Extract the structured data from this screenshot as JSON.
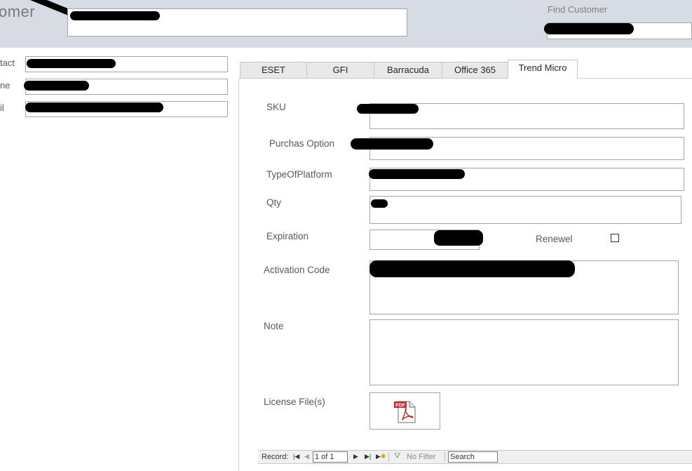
{
  "header": {
    "form_title": "omer",
    "find_customer_label": "Find Customer"
  },
  "customer": {
    "contact_label": "tact",
    "phone_label": "ne",
    "email_label": "il"
  },
  "tabs": [
    {
      "label": "ESET",
      "active": false
    },
    {
      "label": "GFI",
      "active": false
    },
    {
      "label": "Barracuda",
      "active": false
    },
    {
      "label": "Office 365",
      "active": false
    },
    {
      "label": "Trend Micro",
      "active": true
    }
  ],
  "form": {
    "sku_label": "SKU",
    "purchase_option_label": "Purchas Option",
    "platform_label": "TypeOfPlatform",
    "qty_label": "Qty",
    "expiration_label": "Expiration",
    "renewel_label": "Renewel",
    "renewel_checked": false,
    "activation_code_label": "Activation Code",
    "note_label": "Note",
    "license_files_label": "License File(s)",
    "attachment_icon": "pdf-file-icon"
  },
  "navigation": {
    "record_label": "Record:",
    "record_position": "1 of 1",
    "filter_label": "No Filter",
    "search_placeholder": "Search"
  },
  "colors": {
    "header_bg": "#d6dbe4",
    "tab_inactive_bg": "#e8e8e8",
    "redaction": "#000000"
  }
}
